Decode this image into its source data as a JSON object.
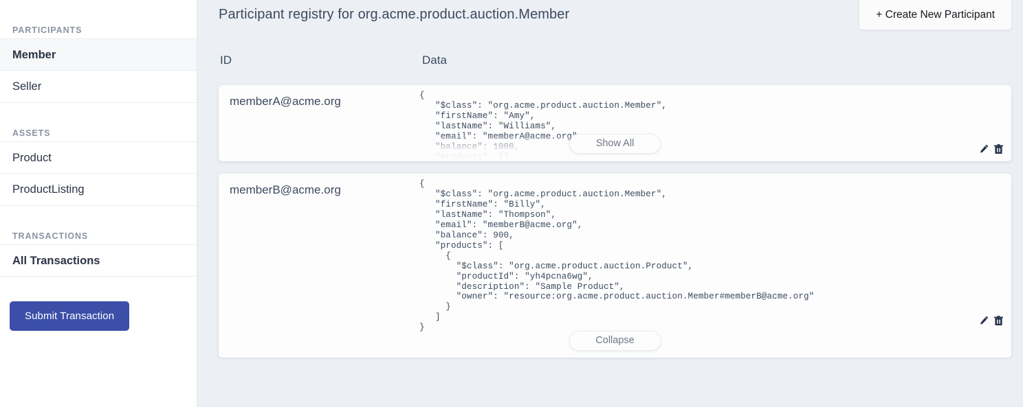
{
  "sidebar": {
    "sections": [
      {
        "title": "PARTICIPANTS",
        "items": [
          {
            "label": "Member",
            "active": true
          },
          {
            "label": "Seller",
            "active": false
          }
        ]
      },
      {
        "title": "ASSETS",
        "items": [
          {
            "label": "Product",
            "active": false
          },
          {
            "label": "ProductListing",
            "active": false
          }
        ]
      },
      {
        "title": "TRANSACTIONS",
        "items": [
          {
            "label": "All Transactions",
            "active": false
          }
        ]
      }
    ],
    "submit_button": "Submit Transaction",
    "accent_color": "#3b4fa8"
  },
  "header": {
    "title": "Participant registry for org.acme.product.auction.Member",
    "create_button": "+ Create New Participant"
  },
  "table": {
    "columns": [
      "ID",
      "Data"
    ],
    "rows": [
      {
        "id": "memberA@acme.org",
        "collapsed": true,
        "toggle_label": "Show All",
        "data": "{\n   \"$class\": \"org.acme.product.auction.Member\",\n   \"firstName\": \"Amy\",\n   \"lastName\": \"Williams\",\n   \"email\": \"memberA@acme.org\",\n   \"balance\": 1000,\n   \"products\": []\n}",
        "edit_icon": "pencil-icon",
        "delete_icon": "trash-icon"
      },
      {
        "id": "memberB@acme.org",
        "collapsed": false,
        "toggle_label": "Collapse",
        "data": "{\n   \"$class\": \"org.acme.product.auction.Member\",\n   \"firstName\": \"Billy\",\n   \"lastName\": \"Thompson\",\n   \"email\": \"memberB@acme.org\",\n   \"balance\": 900,\n   \"products\": [\n     {\n       \"$class\": \"org.acme.product.auction.Product\",\n       \"productId\": \"yh4pcna6wg\",\n       \"description\": \"Sample Product\",\n       \"owner\": \"resource:org.acme.product.auction.Member#memberB@acme.org\"\n     }\n   ]\n}",
        "edit_icon": "pencil-icon",
        "delete_icon": "trash-icon"
      }
    ]
  },
  "colors": {
    "page_background": "#ecf0f5",
    "sidebar_background": "#ffffff",
    "card_background": "#fdfdfd",
    "text_primary": "#3c4a5e",
    "text_muted": "#8b93a1",
    "accent": "#3b4fa8"
  }
}
